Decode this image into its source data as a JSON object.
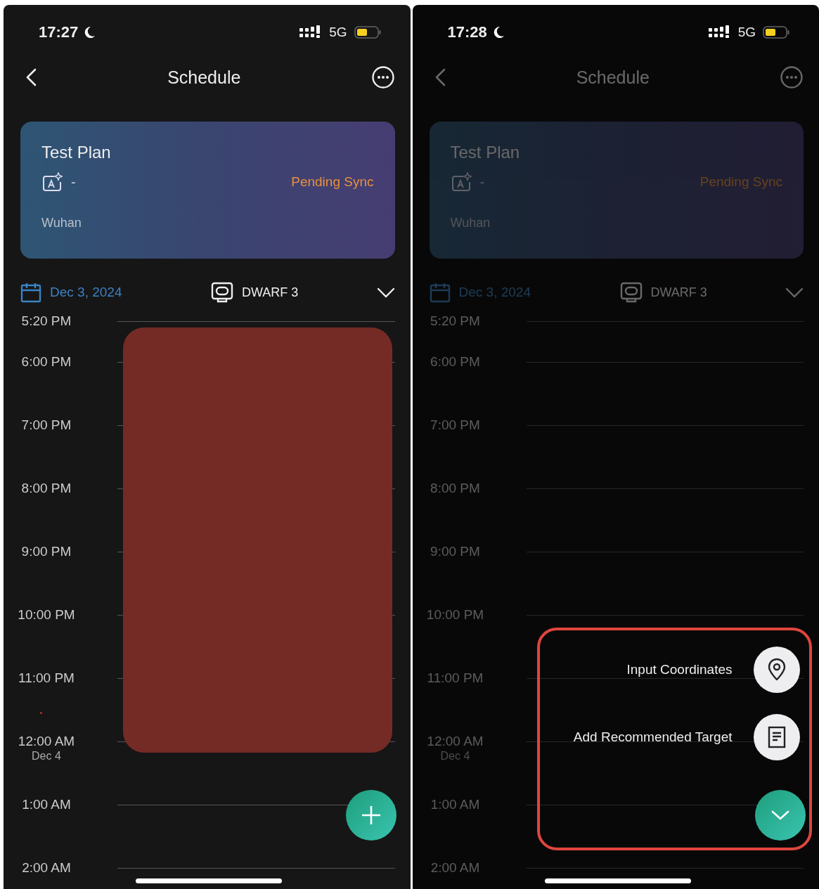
{
  "screens": [
    {
      "status_time": "17:27",
      "network": "5G",
      "title": "Schedule",
      "dimmed": false,
      "plan": {
        "name": "Test Plan",
        "dash": "-",
        "sync": "Pending Sync",
        "location": "Wuhan"
      },
      "date": "Dec 3, 2024",
      "device": "DWARF 3",
      "timeline": [
        {
          "time": "5:20 PM"
        },
        {
          "time": "6:00 PM"
        },
        {
          "time": "7:00 PM"
        },
        {
          "time": "8:00 PM"
        },
        {
          "time": "9:00 PM"
        },
        {
          "time": "10:00 PM"
        },
        {
          "time": "11:00 PM"
        },
        {
          "time": "12:00 AM",
          "date": "Dec 4"
        },
        {
          "time": "1:00 AM"
        },
        {
          "time": "2:00 AM"
        }
      ],
      "event_shown": true,
      "now_marker": true,
      "fab": {
        "expanded": false
      }
    },
    {
      "status_time": "17:28",
      "network": "5G",
      "title": "Schedule",
      "dimmed": true,
      "plan": {
        "name": "Test Plan",
        "dash": "-",
        "sync": "Pending Sync",
        "location": "Wuhan"
      },
      "date": "Dec 3, 2024",
      "device": "DWARF 3",
      "timeline": [
        {
          "time": "5:20 PM"
        },
        {
          "time": "6:00 PM"
        },
        {
          "time": "7:00 PM"
        },
        {
          "time": "8:00 PM"
        },
        {
          "time": "9:00 PM"
        },
        {
          "time": "10:00 PM"
        },
        {
          "time": "11:00 PM"
        },
        {
          "time": "12:00 AM",
          "date": "Dec 4"
        },
        {
          "time": "1:00 AM"
        },
        {
          "time": "2:00 AM"
        }
      ],
      "event_shown": false,
      "now_marker": false,
      "fab": {
        "expanded": true
      },
      "menu": {
        "highlighted": true,
        "items": [
          {
            "label": "Input Coordinates",
            "kind": "pin"
          },
          {
            "label": "Add Recommended Target",
            "kind": "document"
          }
        ]
      }
    }
  ]
}
